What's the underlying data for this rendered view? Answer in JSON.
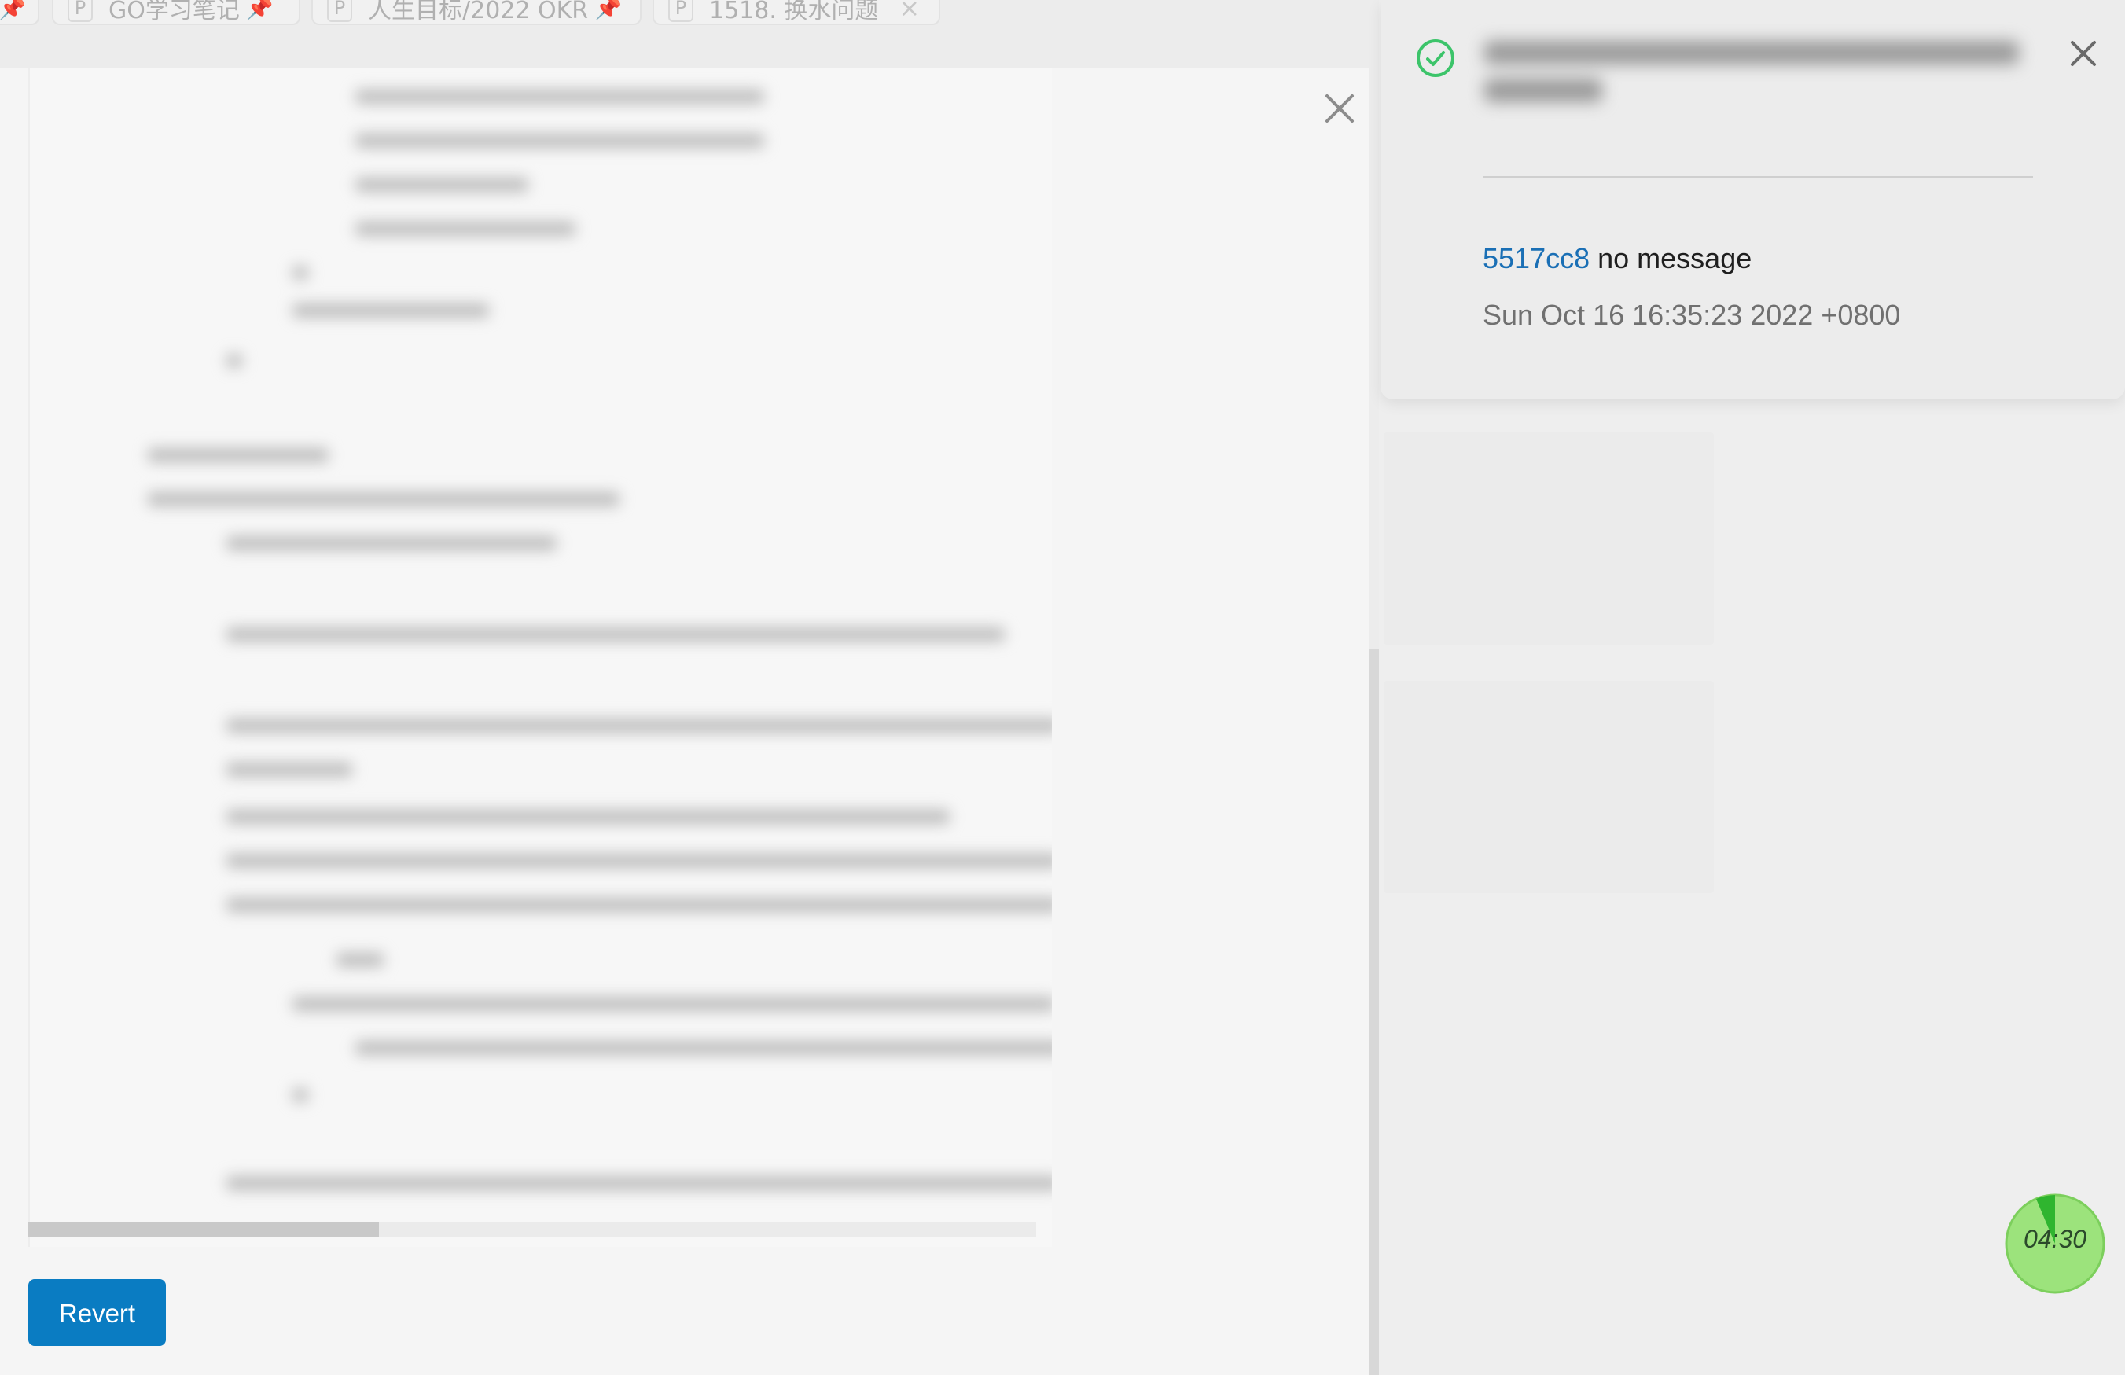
{
  "tabs": [
    {
      "badge": "P",
      "label": "GO学习笔记",
      "pinned": true
    },
    {
      "badge": "P",
      "label": "人生目标/2022 OKR",
      "pinned": true
    },
    {
      "badge": "P",
      "label": "1518. 换水问题",
      "pinned": false
    }
  ],
  "editor": {
    "revert_label": "Revert"
  },
  "notification": {
    "commit_hash": "5517cc8",
    "commit_message": "no message",
    "commit_date": "Sun Oct 16 16:35:23 2022 +0800"
  },
  "timer": {
    "time": "04:30"
  },
  "colors": {
    "accent": "#0a7cc2",
    "success": "#3cc46a",
    "link": "#1a6fb5",
    "timer_fill": "#9ce37c"
  }
}
